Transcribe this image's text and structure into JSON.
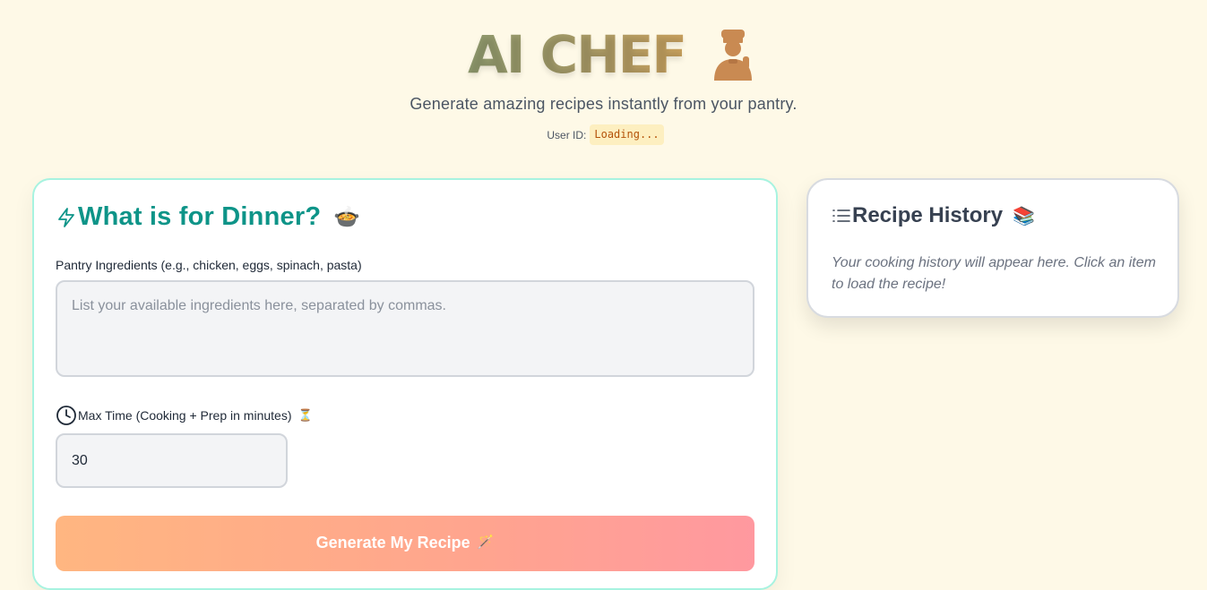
{
  "header": {
    "title": "AI CHEF",
    "chef_icon": "chef-icon",
    "subtitle": "Generate amazing recipes instantly from your pantry.",
    "user_id_label": "User ID:",
    "user_id_value": "Loading..."
  },
  "recipe_form": {
    "title": "What is for Dinner?",
    "title_icon": "lightning-icon",
    "title_emoji": "🍲",
    "ingredients_label": "Pantry Ingredients (e.g., chicken, eggs, spinach, pasta)",
    "ingredients_placeholder": "List your available ingredients here, separated by commas.",
    "ingredients_value": "",
    "time_icon": "clock-icon",
    "time_label": "Max Time (Cooking + Prep in minutes)",
    "time_emoji": "⏳",
    "time_value": "30",
    "generate_label": "Generate My Recipe",
    "generate_emoji": "🪄"
  },
  "history": {
    "title": "Recipe History",
    "title_icon": "list-icon",
    "title_emoji": "📚",
    "empty_text": "Your cooking history will appear here. Click an item to load the recipe!"
  },
  "colors": {
    "background": "#fef9e7",
    "accent_teal": "#0d9488",
    "card_border": "#a7f3e0",
    "button_gradient_start": "#ffb27a",
    "button_gradient_end": "#ff939a",
    "user_id_text": "#b45309"
  }
}
